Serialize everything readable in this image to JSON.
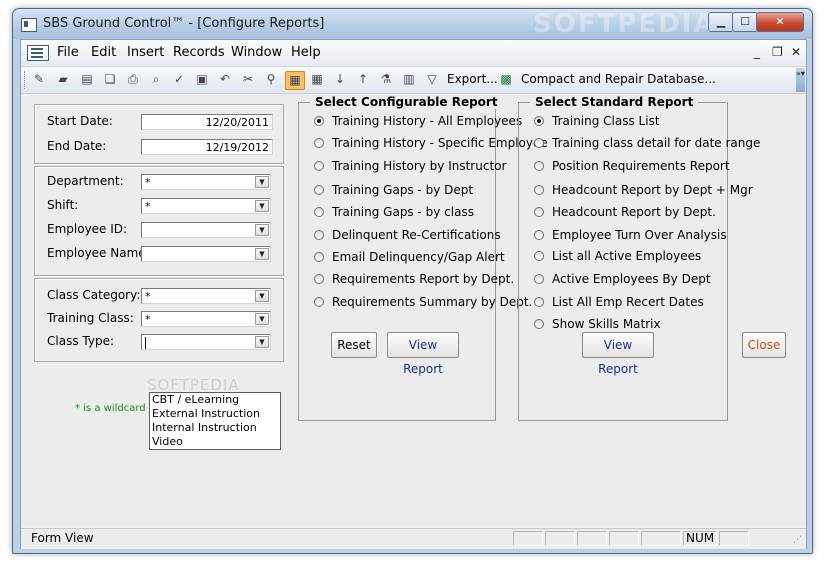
{
  "window": {
    "title": "SBS Ground Control™ - [Configure Reports]",
    "watermark": "SOFTPEDIA",
    "minimize_glyph": "▁",
    "maximize_glyph": "☐",
    "close_glyph": "✕"
  },
  "menubar": {
    "items": [
      "File",
      "Edit",
      "Insert",
      "Records",
      "Window",
      "Help"
    ],
    "mdi_minimize": "_",
    "mdi_restore": "❐",
    "mdi_close": "✕"
  },
  "toolbar": {
    "export_label": "Export...",
    "compact_label": "Compact and Repair Database..."
  },
  "dates": {
    "start_label": "Start Date:",
    "start_value": "12/20/2011",
    "end_label": "End Date:",
    "end_value": "12/19/2012"
  },
  "employee": {
    "department_label": "Department:",
    "department_value": "*",
    "shift_label": "Shift:",
    "shift_value": "*",
    "employee_id_label": "Employee ID:",
    "employee_id_value": "",
    "employee_name_label": "Employee Name:",
    "employee_name_value": ""
  },
  "class": {
    "category_label": "Class Category:",
    "category_value": "*",
    "training_label": "Training Class:",
    "training_value": "*",
    "type_label": "Class Type:",
    "type_value": "",
    "type_options": [
      "CBT / eLearning",
      "External Instruction",
      "Internal Instruction",
      "Video"
    ],
    "wildcard_note": "* is a wildcard in"
  },
  "configurable": {
    "title": "Select Configurable Report",
    "options": [
      "Training History - All Employees",
      "Training History - Specific Employee",
      "Training History by Instructor",
      "Training Gaps - by Dept",
      "Training Gaps - by class",
      "Delinquent Re-Certifications",
      "Email Delinquency/Gap Alert",
      "Requirements Report by Dept.",
      "Requirements Summary by Dept."
    ],
    "selected_index": 0,
    "reset_label": "Reset",
    "view_label": "View Report"
  },
  "standard": {
    "title": "Select Standard Report",
    "options": [
      "Training Class List",
      "Training class detail for date range",
      "Position Requirements Report",
      "Headcount Report by Dept + Mgr",
      "Headcount Report by Dept.",
      "Employee Turn Over Analysis",
      "List all Active Employees",
      "Active Employees By Dept",
      "List All Emp Recert Dates",
      "Show Skills Matrix"
    ],
    "selected_index": 0,
    "view_label": "View Report"
  },
  "close_label": "Close",
  "statusbar": {
    "mode": "Form View",
    "num": "NUM"
  }
}
